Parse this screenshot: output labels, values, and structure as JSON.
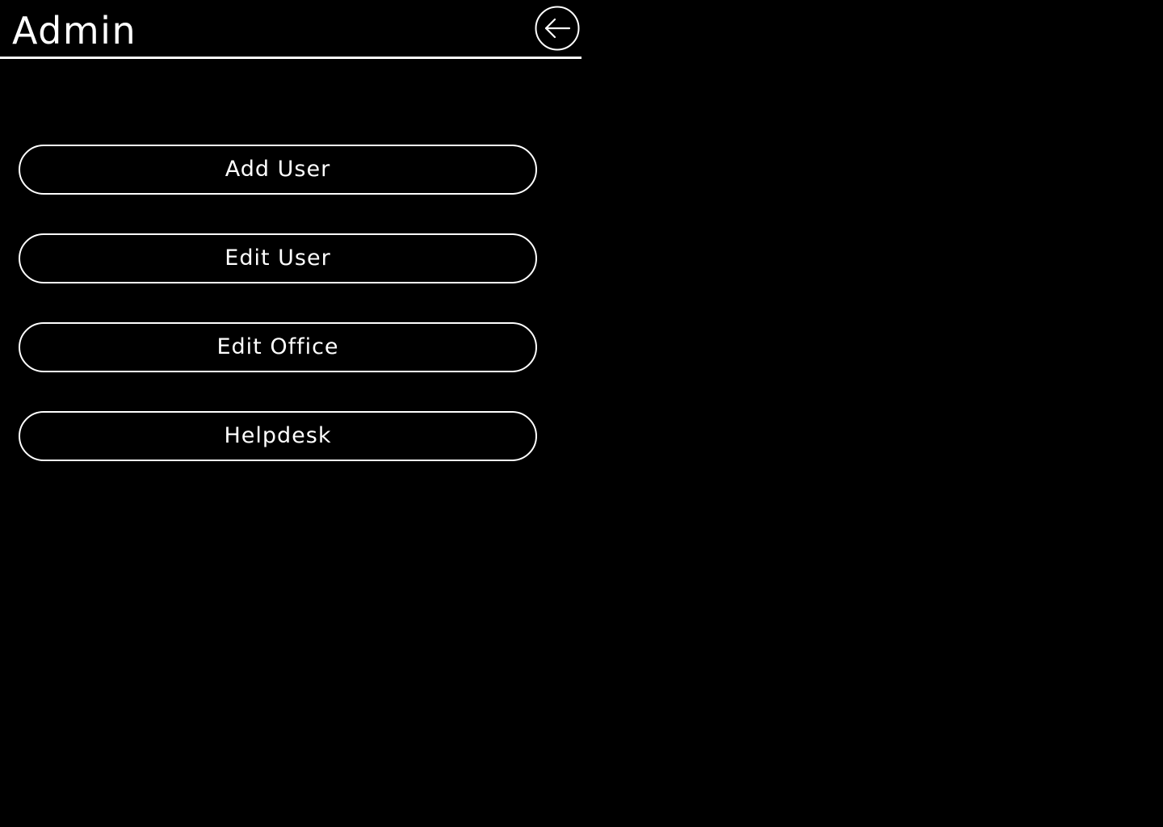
{
  "header": {
    "title": "Admin",
    "back_icon": "arrow-left-circle-icon"
  },
  "menu": {
    "items": [
      {
        "label": "Add User"
      },
      {
        "label": "Edit User"
      },
      {
        "label": "Edit Office"
      },
      {
        "label": "Helpdesk"
      }
    ]
  },
  "colors": {
    "background": "#000000",
    "foreground": "#ffffff"
  }
}
